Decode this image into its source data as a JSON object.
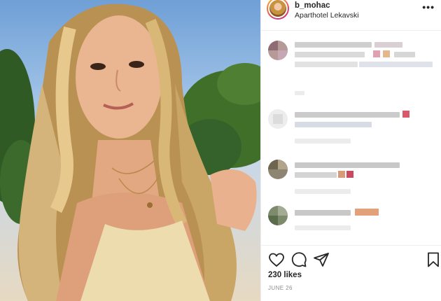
{
  "post": {
    "username": "b_mohac",
    "location": "Aparthotel Lekavski",
    "more_icon": "more-dots-icon",
    "likes": "230 likes",
    "date": "JUNE 26"
  },
  "actions": {
    "icons": [
      "heart-icon",
      "comment-icon",
      "share-icon",
      "bookmark-icon"
    ]
  },
  "comments": {
    "count_visible": 4,
    "content": "pixelated / obscured"
  },
  "colors": {
    "border": "#efefef",
    "text": "#262626",
    "muted": "#8e8e8e"
  }
}
